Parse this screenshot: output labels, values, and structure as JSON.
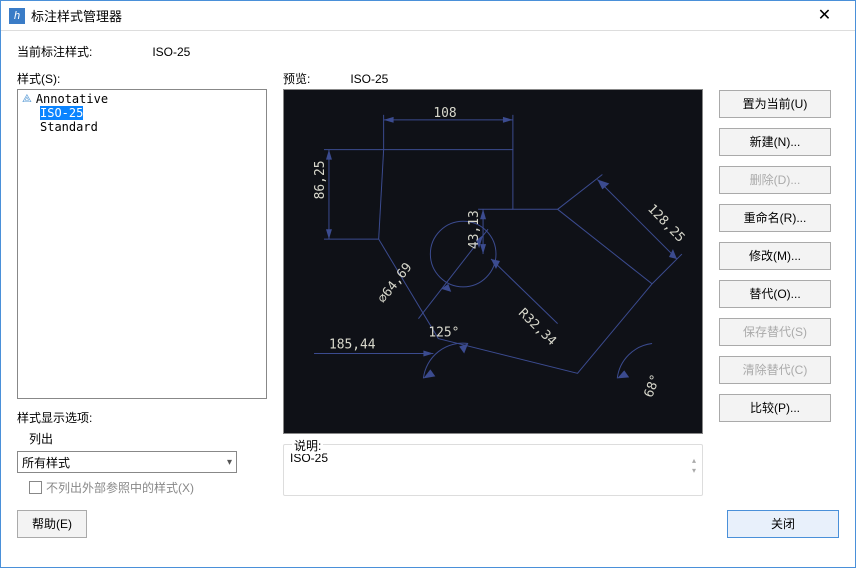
{
  "window": {
    "title": "标注样式管理器"
  },
  "header": {
    "current_style_label": "当前标注样式:",
    "current_style_value": "ISO-25",
    "styles_label": "样式(S):",
    "preview_label": "预览:",
    "preview_name": "ISO-25"
  },
  "styles_list": {
    "items": [
      "Annotative",
      "ISO-25",
      "Standard"
    ],
    "selected": "ISO-25"
  },
  "display_opts": {
    "label": "样式显示选项:",
    "list_label": "列出",
    "combo_value": "所有样式",
    "checkbox_label": "不列出外部参照中的样式(X)",
    "checkbox_checked": false
  },
  "description": {
    "legend": "说明:",
    "text": "ISO-25"
  },
  "dims": {
    "top": "108",
    "left": "86,25",
    "leftbot": "185,44",
    "angle": "125°",
    "diam": "⌀64,69",
    "rad": "R32,34",
    "vert": "43,13",
    "right": "128,25",
    "rightang": "68°"
  },
  "buttons": {
    "set_current": "置为当前(U)",
    "new": "新建(N)...",
    "delete": "删除(D)...",
    "rename": "重命名(R)...",
    "modify": "修改(M)...",
    "override": "替代(O)...",
    "save_override": "保存替代(S)",
    "clear_override": "清除替代(C)",
    "compare": "比较(P)...",
    "help": "帮助(E)",
    "close": "关闭"
  }
}
